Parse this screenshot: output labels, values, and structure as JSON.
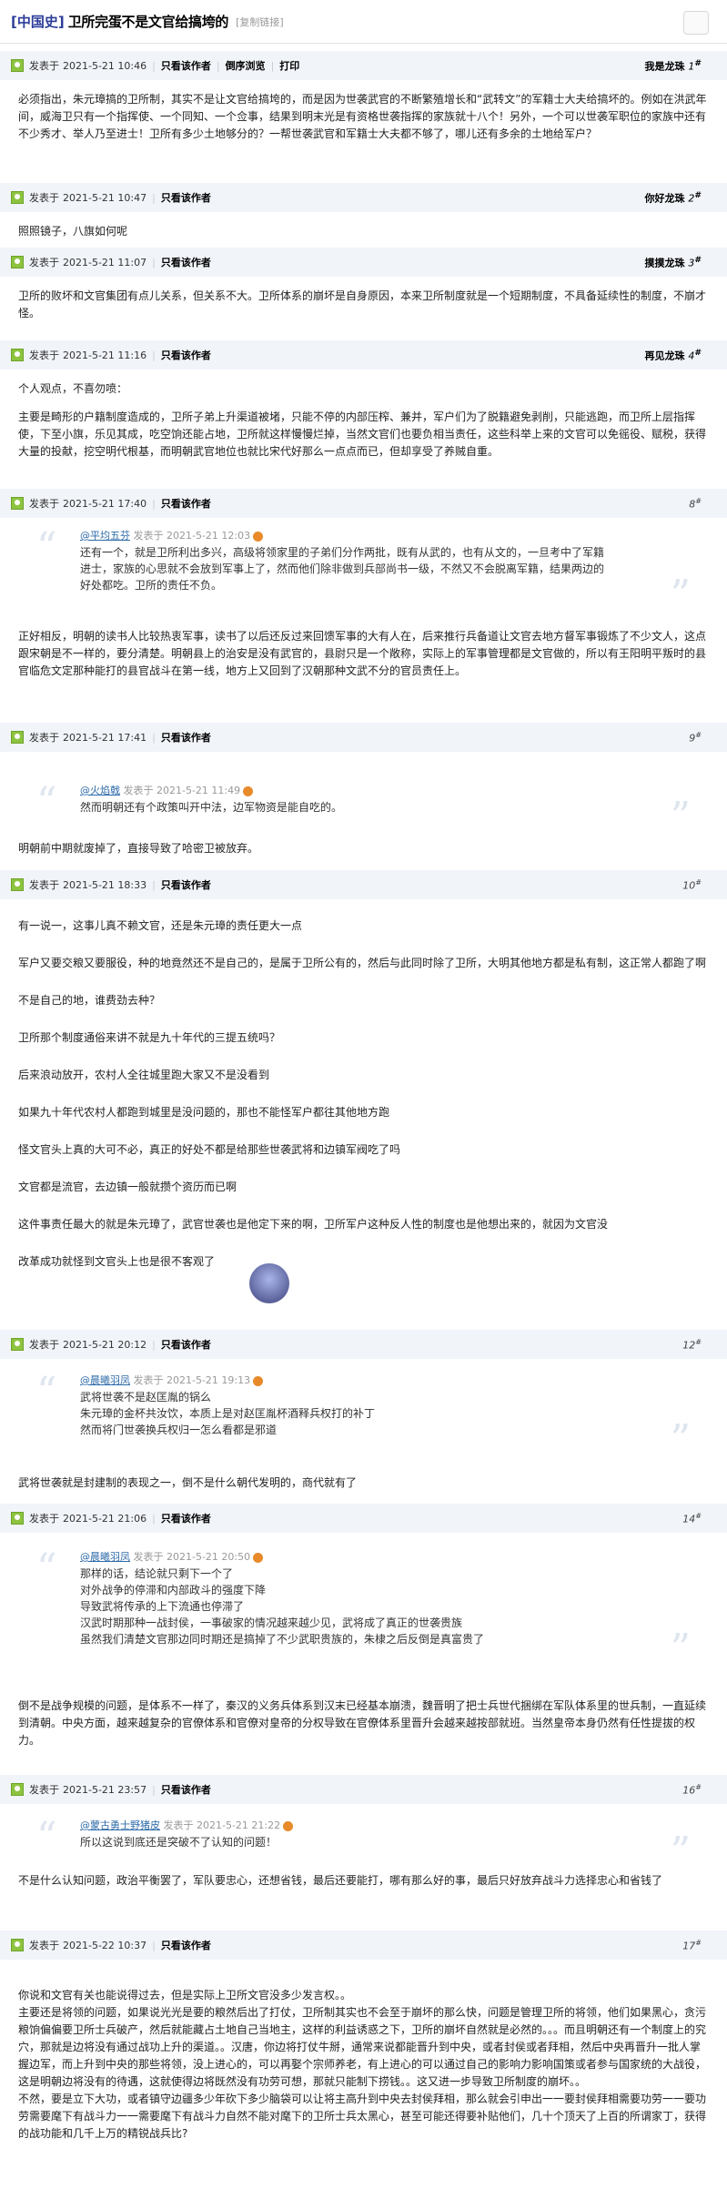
{
  "header": {
    "forum": "[中国史]",
    "title": "卫所完蛋不是文官给搞垮的",
    "copy_link": "[复制链接]"
  },
  "labels": {
    "posted_at": "发表于",
    "only_author": "只看该作者",
    "reverse": "倒序浏览",
    "print": "打印"
  },
  "posts": [
    {
      "time": "2021-5-21 10:46",
      "author": "我是龙珠",
      "floor": "1",
      "body": [
        "必须指出，朱元璋搞的卫所制，其实不是让文官给搞垮的，而是因为世袭武官的不断繁殖增长和“武转文”的军籍士大夫给搞坏的。例如在洪武年间，威海卫只有一个指挥使、一个同知、一个佥事，结果到明末光是有资格世袭指挥的家族就十八个！另外，一个可以世袭军职位的家族中还有不少秀才、举人乃至进士！卫所有多少土地够分的？一帮世袭武官和军籍士大夫都不够了，哪儿还有多余的土地给军户？"
      ]
    },
    {
      "time": "2021-5-21 10:47",
      "author": "你好龙珠",
      "floor": "2",
      "body": [
        "照照镜子，八旗如何呢"
      ]
    },
    {
      "time": "2021-5-21 11:07",
      "author": "摸摸龙珠",
      "floor": "3",
      "body": [
        "卫所的败坏和文官集团有点儿关系，但关系不大。卫所体系的崩坏是自身原因，本来卫所制度就是一个短期制度，不具备延续性的制度，不崩才怪。"
      ]
    },
    {
      "time": "2021-5-21 11:16",
      "author": "再见龙珠",
      "floor": "4",
      "body": [
        "个人观点，不喜勿喷：",
        "主要是畸形的户籍制度造成的，卫所子弟上升渠道被堵，只能不停的内部压榨、兼并，军户们为了脱籍避免剥削，只能逃跑，而卫所上层指挥使，下至小旗，乐见其成，吃空饷还能占地，卫所就这样慢慢烂掉，当然文官们也要负相当责任，这些科举上来的文官可以免徭役、赋税，获得大量的投献，挖空明代根基，而明朝武官地位也就比宋代好那么一点点而已，但却享受了养贼自重。"
      ]
    },
    {
      "time": "2021-5-21 17:40",
      "author": "",
      "floor": "8",
      "quote": {
        "user": "@平均五芬",
        "time": "发表于 2021-5-21 12:03",
        "lines": [
          "还有一个，就是卫所利出多兴，高级将领家里的子弟们分作两批，既有从武的，也有从文的，一旦考中了军籍",
          "进士，家族的心思就不会放到军事上了，然而他们除非做到兵部尚书一级，不然又不会脱离军籍，结果两边的",
          "好处都吃。卫所的责任不负。"
        ]
      },
      "body": [
        "正好相反，明朝的读书人比较热衷军事，读书了以后还反过来回馈军事的大有人在，后来推行兵备道让文官去地方督军事锻炼了不少文人，这点跟宋朝是不一样的，要分清楚。明朝县上的治安是没有武官的，县尉只是一个敞称，实际上的军事管理都是文官做的，所以有王阳明平叛时的县官临危文定那种能打的县官战斗在第一线，地方上又回到了汉朝那种文武不分的官员责任上。"
      ]
    },
    {
      "time": "2021-5-21 17:41",
      "author": "",
      "floor": "9",
      "quote": {
        "user": "@火焰戟",
        "time": "发表于 2021-5-21 11:49",
        "lines": [
          "然而明朝还有个政策叫开中法，边军物资是能自吃的。"
        ]
      },
      "body": [
        "明朝前中期就废掉了，直接导致了哈密卫被放弃。"
      ]
    },
    {
      "time": "2021-5-21 18:33",
      "author": "",
      "floor": "10",
      "body": [
        "有一说一，这事儿真不赖文官，还是朱元璋的责任更大一点",
        "军户又要交粮又要服役，种的地竟然还不是自己的，是属于卫所公有的，然后与此同时除了卫所，大明其他地方都是私有制，这正常人都跑了啊",
        "不是自己的地，谁费劲去种？",
        "卫所那个制度通俗来讲不就是九十年代的三提五统吗？",
        "后来浪动放开，农村人全往城里跑大家又不是没看到",
        "如果九十年代农村人都跑到城里是没问题的，那也不能怪军户都往其他地方跑",
        "怪文官头上真的大可不必，真正的好处不都是给那些世袭武将和边镇军阀吃了吗",
        "文官都是流官，去边镇一般就攒个资历而已啊",
        "这件事责任最大的就是朱元璋了，武官世袭也是他定下来的啊，卫所军户这种反人性的制度也是他想出来的，就因为文官没",
        "改革成功就怪到文官头上也是很不客观了"
      ]
    },
    {
      "time": "2021-5-21 20:12",
      "author": "",
      "floor": "12",
      "quote": {
        "user": "@晨曦羽凤",
        "time": "发表于 2021-5-21 19:13",
        "lines": [
          "武将世袭不是赵匡胤的锅么",
          "朱元璋的金杯共汝饮，本质上是对赵匡胤杯酒释兵权打的补丁",
          "然而将门世袭换兵权归一怎么看都是邪道"
        ]
      },
      "body": [
        "武将世袭就是封建制的表现之一，倒不是什么朝代发明的，商代就有了"
      ]
    },
    {
      "time": "2021-5-21 21:06",
      "author": "",
      "floor": "14",
      "quote": {
        "user": "@晨曦羽凤",
        "time": "发表于 2021-5-21 20:50",
        "lines": [
          "那样的话，结论就只剩下一个了",
          "对外战争的停滞和内部政斗的强度下降",
          "导致武将传承的上下流通也停滞了",
          "汉武时期那种一战封侯，一事破家的情况越来越少见，武将成了真正的世袭贵族",
          "虽然我们清楚文官那边同时期还是搞掉了不少武职贵族的，朱棣之后反倒是真富贵了"
        ]
      },
      "body": [
        "倒不是战争规模的问题，是体系不一样了，秦汉的义务兵体系到汉末已经基本崩溃，魏晋明了把士兵世代捆绑在军队体系里的世兵制，一直延续到清朝。中央方面，越来越复杂的官僚体系和官僚对皇帝的分权导致在官僚体系里晋升会越来越按部就班。当然皇帝本身仍然有任性提拔的权力。"
      ]
    },
    {
      "time": "2021-5-21 23:57",
      "author": "",
      "floor": "16",
      "quote": {
        "user": "@蒙古勇士野猪皮",
        "time": "发表于 2021-5-21 21:22",
        "lines": [
          "所以这说到底还是突破不了认知的问题！"
        ]
      },
      "body": [
        "不是什么认知问题，政治平衡罢了，军队要忠心，还想省钱，最后还要能打，哪有那么好的事，最后只好放弃战斗力选择忠心和省钱了"
      ]
    },
    {
      "time": "2021-5-22 10:37",
      "author": "",
      "floor": "17",
      "body": [
        "你说和文官有关也能说得过去，但是实际上卫所文官没多少发言权。。",
        "主要还是将领的问题，如果说光光是要的粮然后出了打仗，卫所制其实也不会至于崩坏的那么快，问题是管理卫所的将领，他们如果黑心，贪污粮饷偏偏要卫所士兵破产，然后就能藏占土地自己当地主，这样的利益诱惑之下，卫所的崩坏自然就是必然的。。。而且明朝还有一个制度上的究穴，那就是边将没有通过战功上升的渠道。。汉唐，你边将打仗牛掰，通常来说都能晋升到中央，或者封侯或者拜相，然后中央再晋升一批人掌握边军，而上升到中央的那些将领，没上进心的，可以再娶个宗师养老，有上进心的可以通过自己的影响力影响国策或者参与国家统的大战役，这是明朝边将没有的待遇，这就使得边将既然没有功劳可想，那就只能制下捞钱。。这又进一步导致卫所制度的崩坏。。",
        "不然，要是立下大功，或者镇守边疆多少年砍下多少脑袋可以让将主高升到中央去封侯拜相，那么就会引申出一一要封侯拜相需要功劳一一要功劳需要麾下有战斗力一一需要麾下有战斗力自然不能对麾下的卫所士兵太黑心，甚至可能还得要补贴他们，几十个顶天了上百的所谓家丁，获得的战功能和几千上万的精锐战兵比?"
      ]
    }
  ]
}
